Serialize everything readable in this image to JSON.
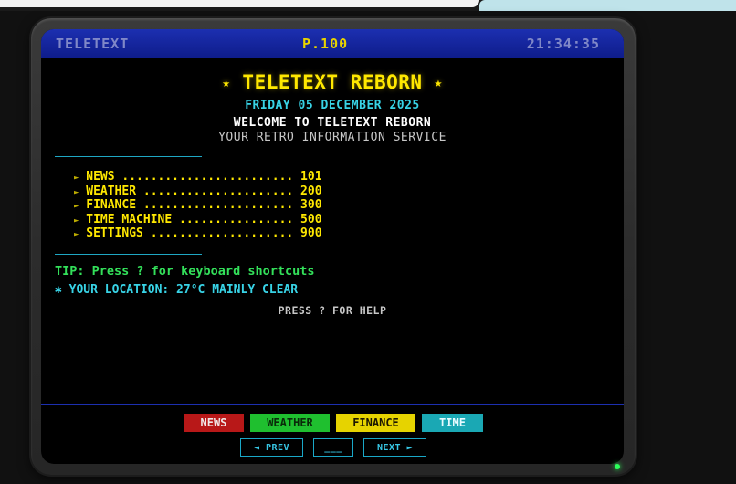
{
  "header": {
    "brand": "TELETEXT",
    "page": "P.100",
    "time": "21:34:35"
  },
  "main": {
    "title": "TELETEXT REBORN",
    "title_star": "★",
    "date": "FRIDAY 05 DECEMBER 2025",
    "welcome": "WELCOME TO TELETEXT REBORN",
    "tagline": "YOUR RETRO INFORMATION SERVICE",
    "menu_arrow": "►",
    "menu": [
      {
        "text": "NEWS ........................ 101"
      },
      {
        "text": "WEATHER ..................... 200"
      },
      {
        "text": "FINANCE ..................... 300"
      },
      {
        "text": "TIME MACHINE ................ 500"
      },
      {
        "text": "SETTINGS .................... 900"
      }
    ],
    "tip": "TIP: Press ? for keyboard shortcuts",
    "location_icon": "✱",
    "location": "YOUR LOCATION: 27°C MAINLY CLEAR",
    "help": "PRESS ? FOR HELP"
  },
  "fastext": {
    "news": "NEWS",
    "weather": "WEATHER",
    "finance": "FINANCE",
    "time": "TIME"
  },
  "nav": {
    "prev": "◄ PREV",
    "page_input": "___",
    "next": "NEXT ►"
  },
  "colors": {
    "header_blue": "#1c2fb0",
    "teletext_yellow": "#ffe800",
    "teletext_cyan": "#38d3e6",
    "teletext_green": "#33e05a",
    "fastext_red": "#b81818",
    "fastext_green": "#1fbf2f",
    "fastext_yellow": "#e6d300",
    "fastext_cyan": "#1aa8b4",
    "power_led": "#2cff5a"
  }
}
